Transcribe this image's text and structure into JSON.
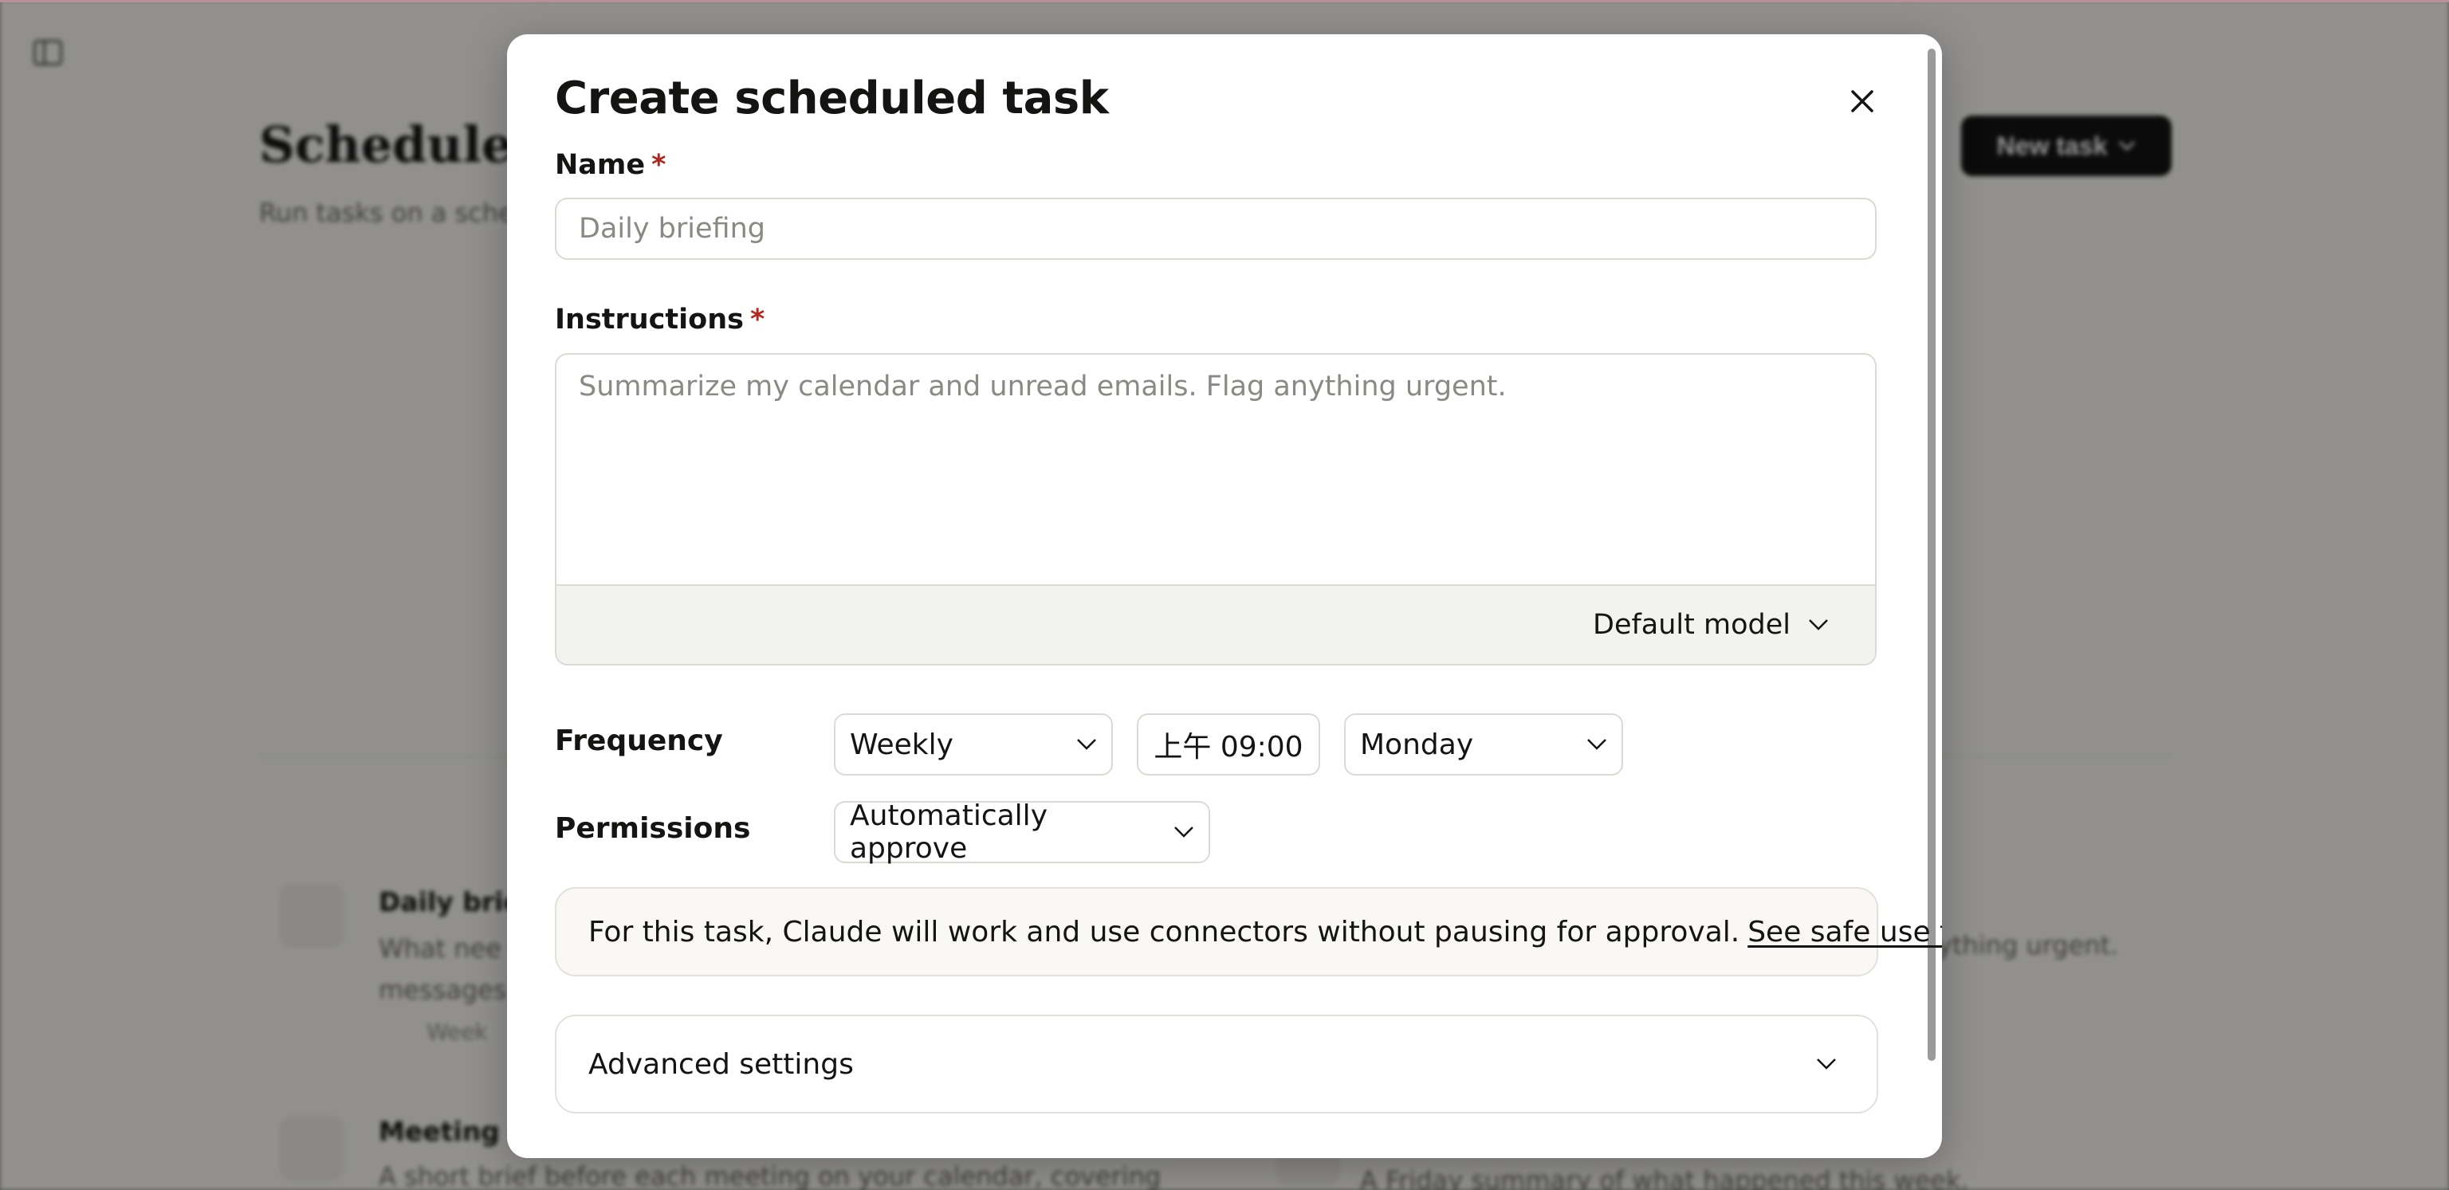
{
  "background": {
    "page_title": "Scheduled",
    "page_subtitle": "Run tasks on a sche",
    "new_task_label": "New task",
    "cards": [
      {
        "title": "Daily brie",
        "desc_line1": "What nee",
        "desc_line2": "messages",
        "meta": "Week"
      },
      {
        "title": "Meeting p",
        "desc_line1": "A short brief before each meeting on your calendar, covering",
        "desc_line2": "",
        "meta": ""
      },
      {
        "title": "",
        "desc_line1": "ything urgent.",
        "desc_line2": "",
        "meta": ""
      },
      {
        "title": "",
        "desc_line1": "A Friday summary of what happened this week.",
        "desc_line2": "",
        "meta": ""
      }
    ]
  },
  "modal": {
    "title": "Create scheduled task",
    "name_label": "Name",
    "required_mark": "*",
    "name_placeholder": "Daily briefing",
    "instructions_label": "Instructions",
    "instructions_placeholder": "Summarize my calendar and unread emails. Flag anything urgent.",
    "model_label": "Default model",
    "frequency_label": "Frequency",
    "frequency_value": "Weekly",
    "time_value": "上午 09:00",
    "day_value": "Monday",
    "permissions_label": "Permissions",
    "permissions_value": "Automatically approve",
    "notice_text": "For this task, Claude will work and use connectors without pausing for approval.",
    "notice_link": "See safe use tips",
    "advanced_label": "Advanced settings"
  },
  "icons": [
    "sidebar-toggle-icon",
    "close-icon",
    "chevron-down-icon",
    "calendar-icon",
    "sun-icon",
    "clock-icon"
  ]
}
